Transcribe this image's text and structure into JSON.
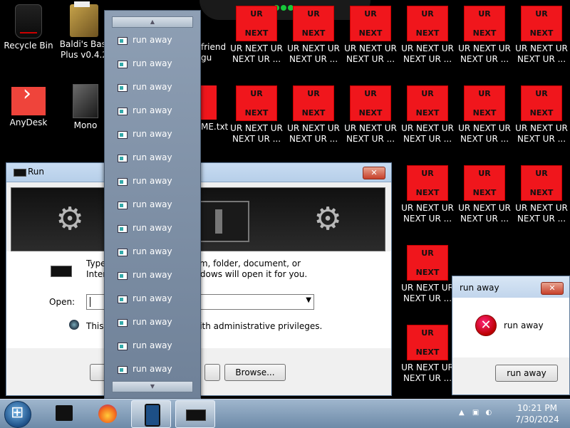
{
  "desktop": {
    "icons": [
      {
        "label": "Recycle Bin"
      },
      {
        "label": "Baldi's Basi Plus v0.4.2"
      },
      {
        "label": "AnyDesk"
      },
      {
        "label": "Mono"
      }
    ],
    "partial_labels": {
      "friend": "friend",
      "gu": "gu",
      "me_txt": "ME.txt"
    },
    "ur_icon": {
      "top_text": "UR",
      "bottom_text": "NEXT",
      "label_line1": "UR NEXT UR",
      "label_line2": "NEXT UR ..."
    }
  },
  "run_dialog": {
    "title": "Run",
    "description": "Type the name of a program, folder, document, or Internet resource, and Windows will open it for you.",
    "open_label": "Open:",
    "open_value": "",
    "admin_note": "This task will be created with administrative privileges.",
    "browse_label": "Browse..."
  },
  "menu": {
    "items": [
      {
        "label": "run away"
      },
      {
        "label": "run away"
      },
      {
        "label": "run away"
      },
      {
        "label": "run away"
      },
      {
        "label": "run away"
      },
      {
        "label": "run away"
      },
      {
        "label": "run away"
      },
      {
        "label": "run away"
      },
      {
        "label": "run away"
      },
      {
        "label": "run away"
      },
      {
        "label": "run away"
      },
      {
        "label": "run away"
      },
      {
        "label": "run away"
      },
      {
        "label": "run away"
      },
      {
        "label": "run away"
      }
    ]
  },
  "message_box": {
    "title": "run away",
    "message": "run away",
    "button_label": "run away"
  },
  "taskbar": {
    "time": "10:21 PM",
    "date": "7/30/2024"
  }
}
